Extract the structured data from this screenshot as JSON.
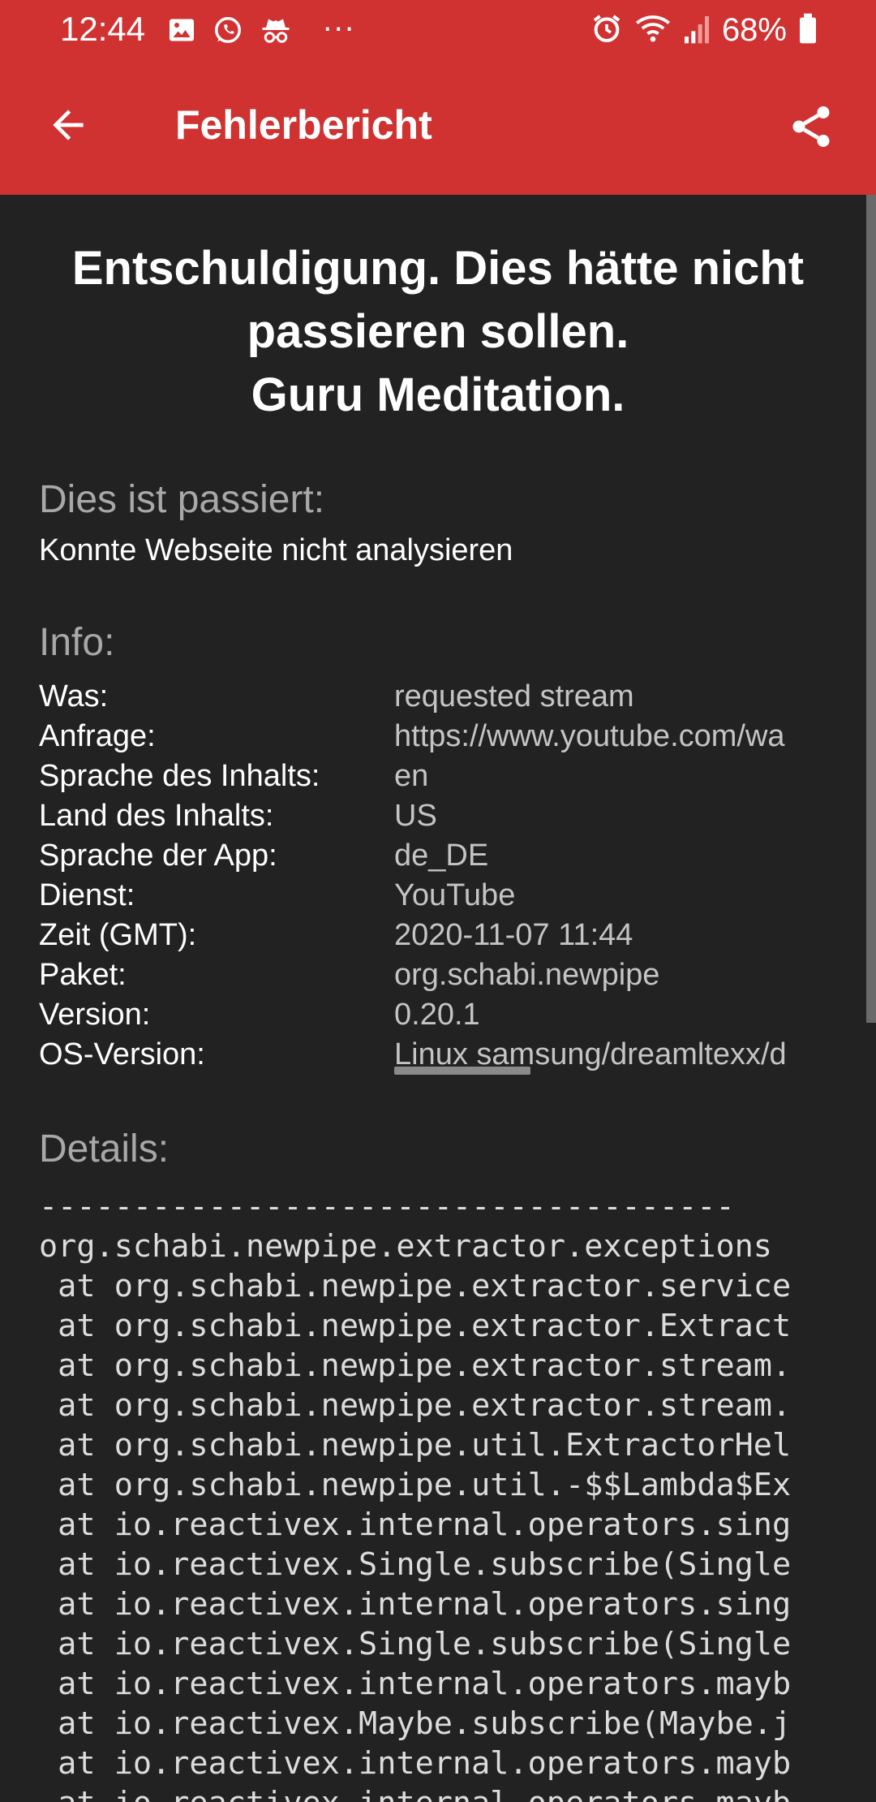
{
  "status_bar": {
    "time": "12:44",
    "left_icons": [
      "image-icon",
      "whatsapp-icon",
      "incognito-icon"
    ],
    "more_indicator": "···",
    "right_icons": [
      "alarm-icon",
      "wifi-icon",
      "signal-icon",
      "battery-icon"
    ],
    "battery_percent": "68%"
  },
  "app_bar": {
    "title": "Fehlerbericht",
    "back_icon": "back-arrow-icon",
    "share_icon": "share-icon",
    "background_color": "#d03232"
  },
  "heading": {
    "line1": "Entschuldigung. Dies hätte nicht",
    "line2": "passieren sollen.",
    "line3": "Guru Meditation."
  },
  "what_happened": {
    "title": "Dies ist passiert:",
    "message": "Konnte Webseite nicht analysieren"
  },
  "info": {
    "title": "Info:",
    "rows": [
      {
        "key": "Was:",
        "value": "requested stream"
      },
      {
        "key": "Anfrage:",
        "value": "https://www.youtube.com/wa"
      },
      {
        "key": "Sprache des Inhalts:",
        "value": "en"
      },
      {
        "key": "Land des Inhalts:",
        "value": "US"
      },
      {
        "key": "Sprache der App:",
        "value": "de_DE"
      },
      {
        "key": "Dienst:",
        "value": "YouTube"
      },
      {
        "key": "Zeit (GMT):",
        "value": "2020-11-07 11:44"
      },
      {
        "key": "Paket:",
        "value": "org.schabi.newpipe"
      },
      {
        "key": "Version:",
        "value": "0.20.1"
      },
      {
        "key": "OS-Version:",
        "value": "Linux samsung/dreamltexx/d"
      }
    ]
  },
  "details": {
    "title": "Details:",
    "lines": [
      "-------------------------------------",
      "org.schabi.newpipe.extractor.exceptions",
      " at org.schabi.newpipe.extractor.service",
      " at org.schabi.newpipe.extractor.Extract",
      " at org.schabi.newpipe.extractor.stream.",
      " at org.schabi.newpipe.extractor.stream.",
      " at org.schabi.newpipe.util.ExtractorHel",
      " at org.schabi.newpipe.util.-$$Lambda$Ex",
      " at io.reactivex.internal.operators.sing",
      " at io.reactivex.Single.subscribe(Single",
      " at io.reactivex.internal.operators.sing",
      " at io.reactivex.Single.subscribe(Single",
      " at io.reactivex.internal.operators.mayb",
      " at io.reactivex.Maybe.subscribe(Maybe.j",
      " at io.reactivex.internal.operators.mayb",
      " at io.reactivex.internal.operators.mayb"
    ]
  }
}
